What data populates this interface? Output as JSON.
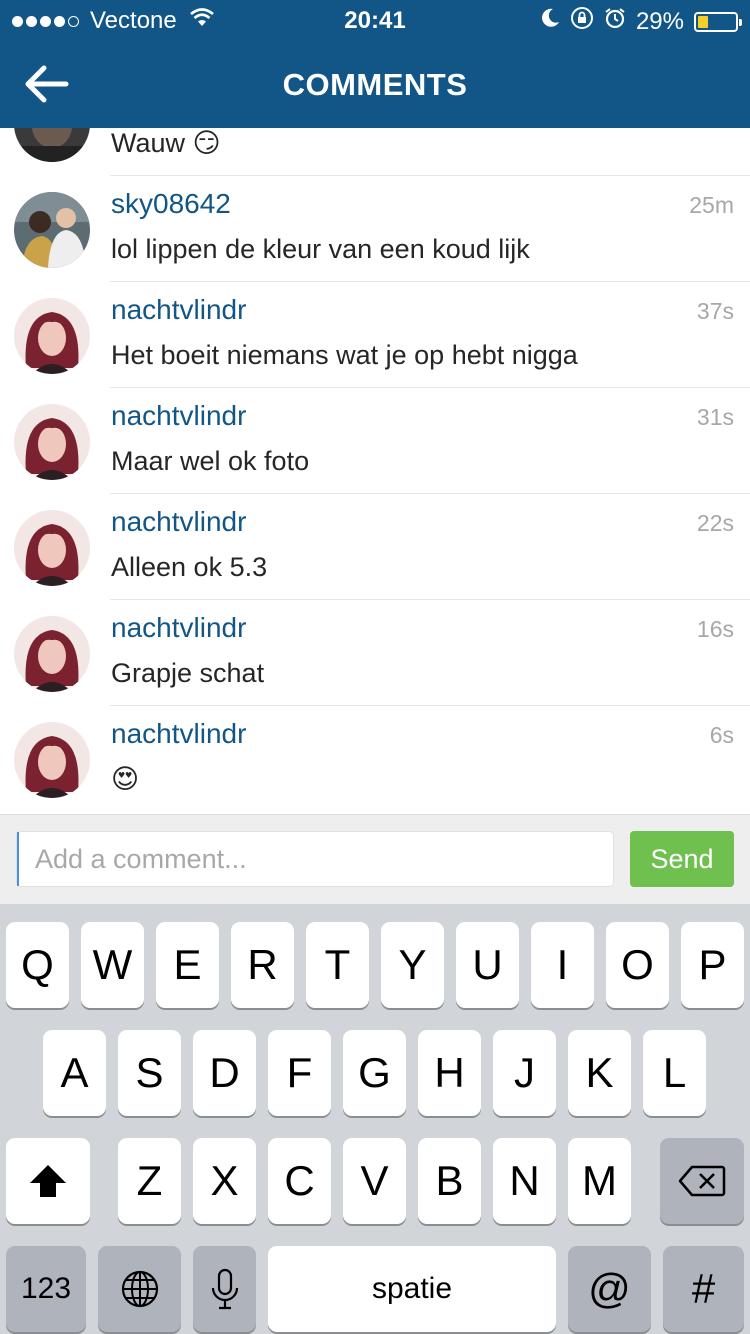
{
  "status_bar": {
    "carrier": "Vectone",
    "time": "20:41",
    "battery_text": "29%",
    "battery_level": 0.29,
    "signal_filled": 4,
    "signal_total": 5
  },
  "nav": {
    "title": "COMMENTS",
    "back_icon": "back-arrow-icon"
  },
  "comments": [
    {
      "username": "",
      "time": "",
      "text": "Wauw 😏",
      "avatar": "partial-avatar"
    },
    {
      "username": "sky08642",
      "time": "25m",
      "text": "lol lippen de kleur van een koud lijk",
      "avatar": "two-men-avatar"
    },
    {
      "username": "nachtvlindr",
      "time": "37s",
      "text": "Het boeit niemans wat je op hebt nigga",
      "avatar": "woman-red-hair-avatar"
    },
    {
      "username": "nachtvlindr",
      "time": "31s",
      "text": "Maar wel ok foto",
      "avatar": "woman-red-hair-avatar"
    },
    {
      "username": "nachtvlindr",
      "time": "22s",
      "text": "Alleen ok 5.3",
      "avatar": "woman-red-hair-avatar"
    },
    {
      "username": "nachtvlindr",
      "time": "16s",
      "text": "Grapje schat",
      "avatar": "woman-red-hair-avatar"
    },
    {
      "username": "nachtvlindr",
      "time": "6s",
      "text": "😍",
      "avatar": "woman-red-hair-avatar"
    }
  ],
  "comment_input": {
    "placeholder": "Add a comment...",
    "value": ""
  },
  "send_label": "Send",
  "colors": {
    "header": "#125688",
    "username": "#125688",
    "send": "#70c050",
    "keyboard_bg": "#d1d4d9"
  },
  "keyboard": {
    "row1": [
      "Q",
      "W",
      "E",
      "R",
      "T",
      "Y",
      "U",
      "I",
      "O",
      "P"
    ],
    "row2": [
      "A",
      "S",
      "D",
      "F",
      "G",
      "H",
      "J",
      "K",
      "L"
    ],
    "row3": [
      "Z",
      "X",
      "C",
      "V",
      "B",
      "N",
      "M"
    ],
    "numbers_label": "123",
    "space_label": "spatie",
    "at_label": "@",
    "hash_label": "#"
  }
}
